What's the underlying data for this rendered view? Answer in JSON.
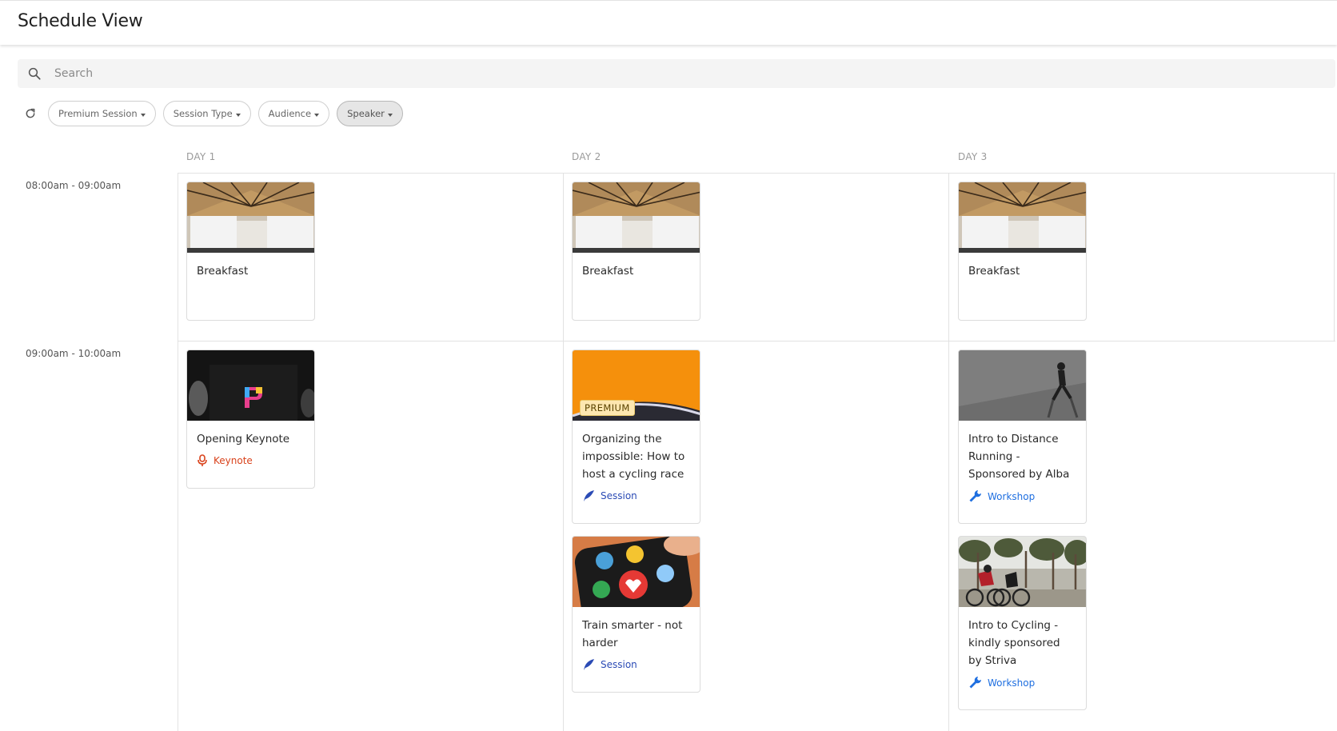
{
  "header": {
    "title": "Schedule View"
  },
  "search": {
    "placeholder": "Search",
    "value": "",
    "icon": "search-icon"
  },
  "filters": {
    "refresh_icon": "refresh-icon",
    "chips": [
      "Premium Session",
      "Session Type",
      "Audience",
      "Speaker"
    ],
    "active_chip": "Speaker"
  },
  "days": [
    "DAY 1",
    "DAY 2",
    "DAY 3"
  ],
  "time_slots": [
    "08:00am - 09:00am",
    "09:00am - 10:00am"
  ],
  "sessions": {
    "day1": {
      "breakfast": {
        "title": "Breakfast"
      },
      "keynote": {
        "title": "Opening Keynote",
        "type": "Keynote",
        "type_icon": "microphone-icon",
        "type_color": "#d9421b"
      }
    },
    "day2": {
      "breakfast": {
        "title": "Breakfast"
      },
      "cycling_race": {
        "title": "Organizing the impossible: How to host a cycling race",
        "badge": "PREMIUM",
        "type": "Session",
        "type_icon": "quill-icon",
        "type_color": "#2b4bb5"
      },
      "train_smarter": {
        "title": "Train smarter - not harder",
        "type": "Session",
        "type_icon": "quill-icon",
        "type_color": "#2b4bb5"
      }
    },
    "day3": {
      "breakfast": {
        "title": "Breakfast"
      },
      "distance_running": {
        "title": "Intro to Distance Running - Sponsored by Alba",
        "type": "Workshop",
        "type_icon": "wrench-icon",
        "type_color": "#1f6fe0"
      },
      "cycling": {
        "title": "Intro to Cycling - kindly sponsored by Striva",
        "type": "Workshop",
        "type_icon": "wrench-icon",
        "type_color": "#1f6fe0"
      }
    }
  }
}
